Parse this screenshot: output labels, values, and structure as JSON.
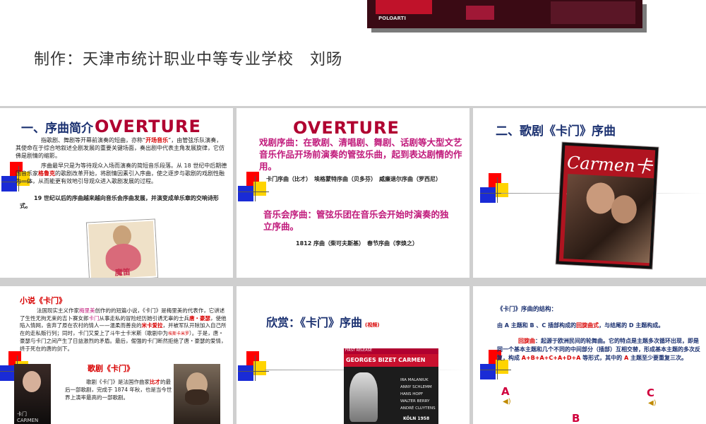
{
  "hero": {
    "label": "POLOARTI"
  },
  "credit": "制作：天津市统计职业中等专业学校　刘旸",
  "slide1": {
    "title": "一、序曲简介",
    "overture": "OVERTURE",
    "p1a": "指歌剧、舞剧等开幕前演奏的短曲，亦称“",
    "p1b": "开场音乐",
    "p1c": "”，由管弦乐队演奏，其使命在于综合地叙述全剧发展的重要关键场面，奏出剧中代表主角发展旋律，它仿佛是剧情的缩影。",
    "p2a": "序曲最早只是为等待观众入场而演奏的简短音乐段落。从 18 世纪中后期德国音乐家",
    "p2b": "格鲁克",
    "p2c": "的歌剧改革开始，将剧情因素引入序曲，使之逐步与歌剧的戏剧性融为一体，从而能更有效地引导观众进入歌剧发展的过程。",
    "p3": "19 世纪以后的序曲越来越向音乐会序曲发展，并演变成单乐章的交响诗形式。",
    "poster_caption": "魔笛"
  },
  "slide2": {
    "overture": "OVERTURE",
    "line1": "戏剧序曲：在歌剧、清唱剧、舞剧、话剧等大型文艺音乐作品开场前演奏的管弦乐曲，起到表达剧情的作用。",
    "examples1": "卡门序曲（比才）　埃格蒙特序曲（贝多芬）　威廉退尔序曲（罗西尼）",
    "line2": "音乐会序曲：管弦乐团在音乐会开始时演奏的独立序曲。",
    "examples2": "1812 序曲（柴可夫斯基）　春节序曲（李焕之）"
  },
  "slide3": {
    "title": "二、歌剧《卡门》序曲",
    "poster_title": "Carmen卡门"
  },
  "slide4": {
    "novel_title": "小说《卡门》",
    "novel_a": "法国现实主义作家",
    "novel_b": "梅里美",
    "novel_c": "创作的的短篇小说，《卡门》是梅里美的代表作，它讲述了生性无拘无束的吉卜赛女郎",
    "novel_d": "卡门",
    "novel_e": "从事走私的冒险经历她引诱无辜的士兵",
    "novel_f": "唐・豪瑟",
    "novel_g": "，使他陷入情网，舍弃了原在农村的情人——温柔而善良的",
    "novel_h": "米卡爱拉",
    "novel_i": "，并被军队开除加入自己所在的走私贩行列；同时，卡门又爱上了斗牛士卡米斯（歌剧中为",
    "novel_j": "埃斯卡米罗",
    "novel_k": "）。于是，唐・豪瑟与卡门之间产生了日益激烈的矛盾。最后，倔强的卡门断然拒绝了唐・豪瑟的爱情，终于死在的唐的剑下。",
    "opera_title": "歌剧《卡门》",
    "opera_a": "歌剧《卡门》是法国作曲家",
    "opera_b": "比才",
    "opera_c": "的最后一部歌剧，完成于 1874 年秋，也是当今世界上演率最高的一部歌剧。",
    "poster_caption": "卡门 CARMEN"
  },
  "slide5": {
    "title": "欣赏：《卡门》序曲",
    "title_suffix": "(视频)",
    "record_top": "FIRST RELEASE",
    "record_title": "GEORGES BIZET  CARMEN",
    "credits": [
      "IRA MALANIUK",
      "ANNY SCHLEMM",
      "HANS HOPF",
      "WALTER BERRY",
      "ANDRÉ CLUYTENS"
    ],
    "record_bottom": "KÖLN 1958"
  },
  "slide6": {
    "structure": "《卡门》序曲的结构：",
    "line1a": "由 A 主题和 B 、C 插部构成的",
    "line1b": "回旋曲式",
    "line1c": "，与结尾的 D 主题构成。",
    "rondo_a": "回旋曲",
    "rondo_b": "：起源于欧洲民间的轮舞曲。它的特点是主题多次循环出现，即是同一个基本主题和几个不同的中间部分（插部）互相交替，形成基本主题的多次反复，构成 ",
    "rondo_formula": "A+B+A+C+A+D+A",
    "rondo_c": " 等形式，其中的 ",
    "rondo_d": "A",
    "rondo_e": " 主题至少要重复三次。",
    "letters": [
      "A",
      "C",
      "B"
    ]
  }
}
